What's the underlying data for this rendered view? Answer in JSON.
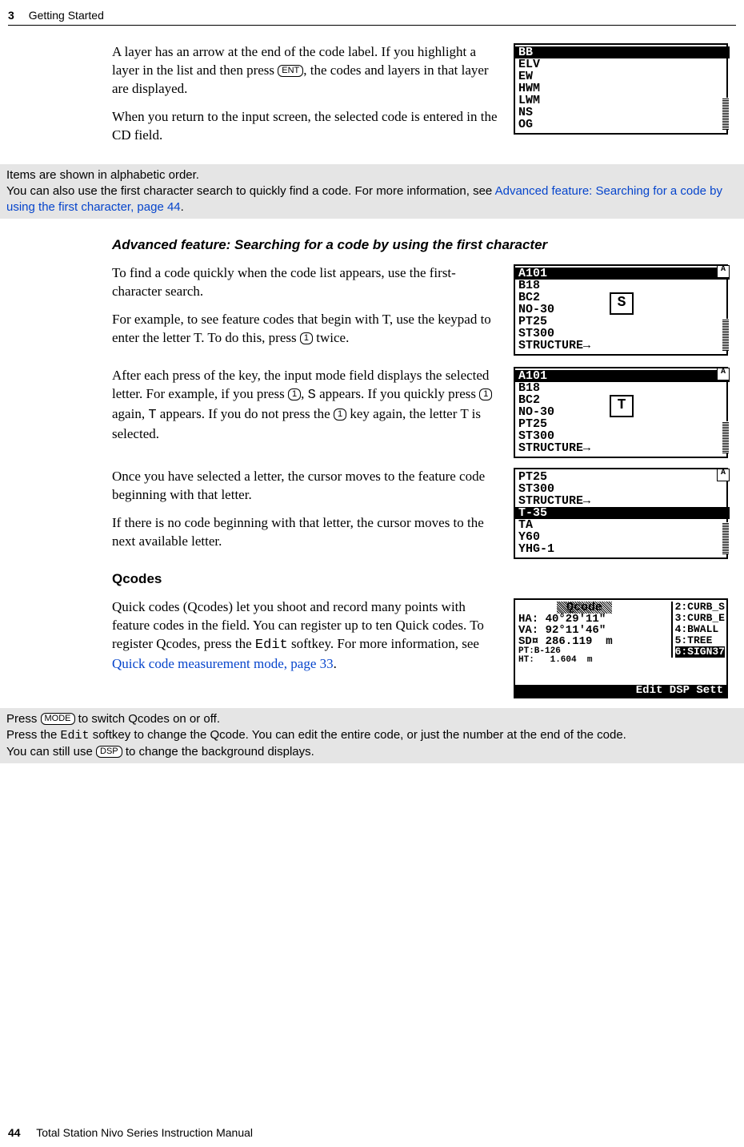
{
  "header": {
    "chapter_number": "3",
    "chapter_title": "Getting Started"
  },
  "footer": {
    "page_number": "44",
    "book_title": "Total Station Nivo Series Instruction Manual"
  },
  "keys": {
    "ent": "ENT",
    "one": "1",
    "mode": "MODE",
    "dsp": "DSP"
  },
  "mono": {
    "s_glyph": "S",
    "t_glyph": "T",
    "edit": "Edit"
  },
  "body": {
    "layer_p1a": "A layer has an arrow at the end of the code label. If you highlight a layer in the list and then press ",
    "layer_p1b": ", the codes and layers in that layer are displayed.",
    "layer_p2": "When you return to the input screen, the selected code is entered in the CD field."
  },
  "note1": {
    "l1": "Items are shown in alphabetic order.",
    "l2a": "You can also use the first character search to quickly find a code. For more information, see ",
    "link": "Advanced feature: Searching for a code by using the first character, page 44",
    "l2b": "."
  },
  "adv": {
    "heading": "Advanced feature: Searching for a code by using the first character",
    "p1": "To find a code quickly when the code list appears, use the first-character search.",
    "p2a": "For example, to see feature codes that begin with T, use the keypad to enter the letter T. To do this, press ",
    "p2b": " twice.",
    "p3a": "After each press of the key, the input mode field displays the selected letter. For example, if you press ",
    "p3b": ", ",
    "p3c": " appears. If you quickly press ",
    "p3d": " again, ",
    "p3e": " appears. If you do not press the ",
    "p3f": " key again, the letter T is selected.",
    "p4": "Once you have selected a letter, the cursor moves to the feature code beginning with that letter.",
    "p5": "If there is no code beginning with that letter, the cursor moves to the next available letter."
  },
  "qcodes": {
    "heading": "Qcodes",
    "p1a": "Quick codes (Qcodes) let you shoot and record many points with feature codes in the field. You can register up to ten Quick codes. To register Qcodes, press the ",
    "p1b": " softkey. For more information, see ",
    "link": "Quick code measurement mode, page 33",
    "p1c": "."
  },
  "note2": {
    "l1a": "Press ",
    "l1b": " to switch Qcodes on or off.",
    "l2a": "Press the ",
    "l2b": " softkey to change the Qcode. You can edit the entire code, or just the number at the end of the code.",
    "l3a": "You can still use ",
    "l3b": " to change the background displays."
  },
  "screens": {
    "s1": {
      "lines": [
        "BB",
        "ELV",
        "EW",
        "HWM",
        "LWM",
        "NS",
        "OG"
      ],
      "highlight_index": 0
    },
    "s2": {
      "lines": [
        "A101",
        "B18",
        "BC2",
        "NO-30",
        "PT25",
        "ST300",
        "STRUCTURE→"
      ],
      "highlight_index": 0,
      "float_letter": "S",
      "mode_ind": "A"
    },
    "s3": {
      "lines": [
        "A101",
        "B18",
        "BC2",
        "NO-30",
        "PT25",
        "ST300",
        "STRUCTURE→"
      ],
      "highlight_index": 0,
      "float_letter": "T",
      "mode_ind": "A"
    },
    "s4": {
      "lines": [
        "PT25",
        "ST300",
        "STRUCTURE→",
        "T-35",
        "TA",
        "Y60",
        "YHG-1"
      ],
      "highlight_index": 3,
      "mode_ind": "A"
    },
    "s5": {
      "title": "Qcode",
      "main": [
        "HA: 40°29'11\"",
        "VA: 92°11'46\"",
        "SD¤ 286.119  m",
        "PT:B-126",
        "HT:   1.604  m"
      ],
      "right": [
        "2:CURB_S",
        "3:CURB_E",
        "4:BWALL",
        "5:TREE",
        "6:SIGN37"
      ],
      "right_inv_index": 4,
      "softkeys": "Edit  DSP  Sett"
    }
  }
}
